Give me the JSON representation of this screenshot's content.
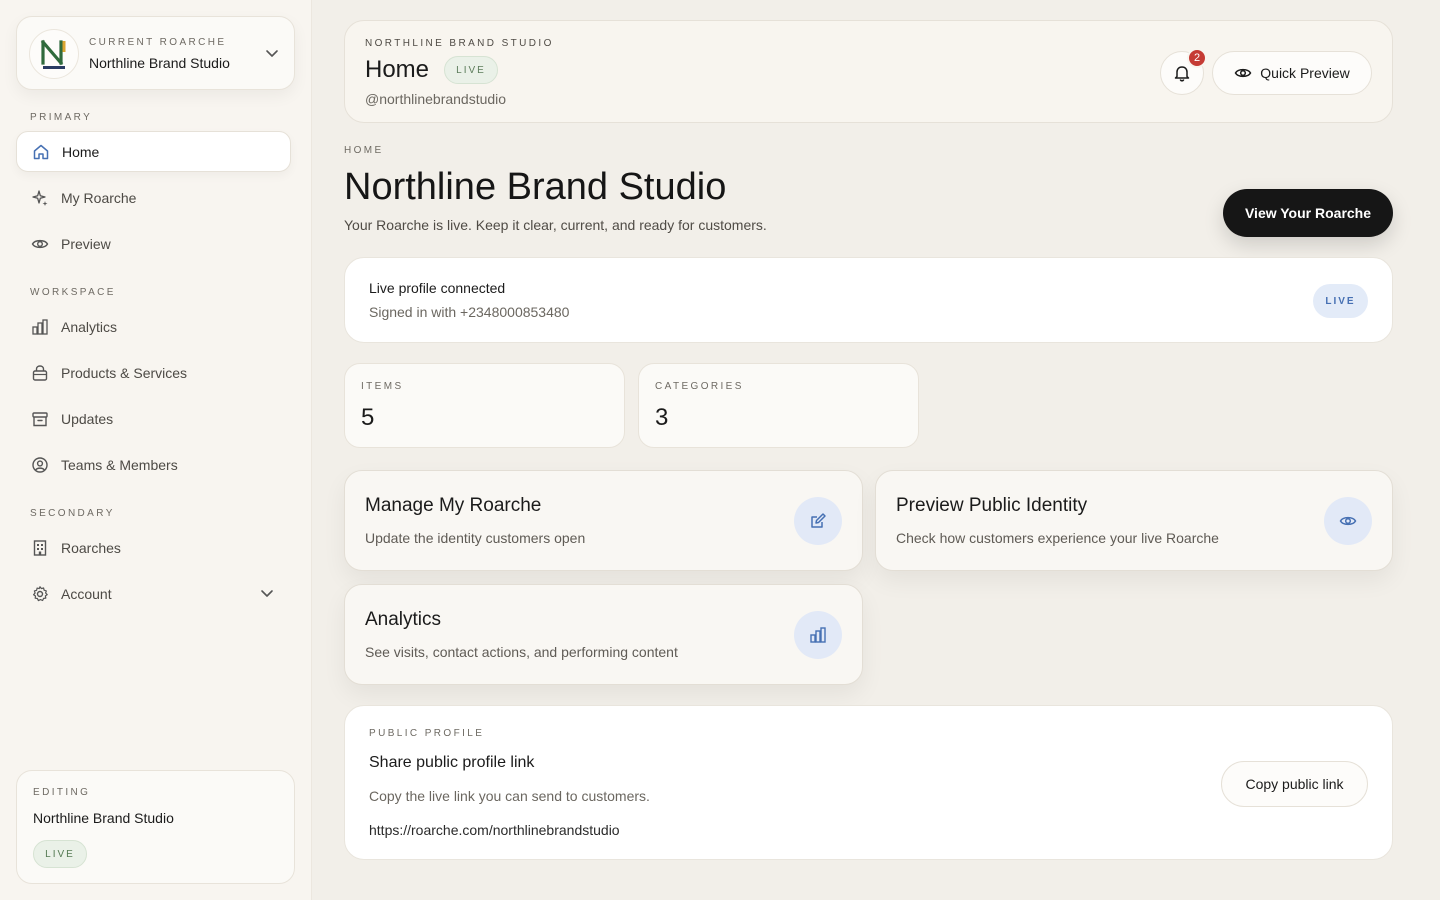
{
  "colors": {
    "accent": "#4670b3",
    "live_green": "#557a53",
    "badge_red": "#c53b34",
    "dark_button": "#161616"
  },
  "sidebar": {
    "switcher": {
      "eyebrow": "CURRENT ROARCHE",
      "name": "Northline Brand Studio",
      "logo_icon": "n-monogram-logo",
      "chevron_icon": "chevron-down-icon"
    },
    "sections": {
      "primary": "PRIMARY",
      "workspace": "WORKSPACE",
      "secondary": "SECONDARY"
    },
    "items": [
      {
        "label": "Home",
        "icon": "home-icon",
        "active": true
      },
      {
        "label": "My Roarche",
        "icon": "sparkle-icon"
      },
      {
        "label": "Preview",
        "icon": "eye-icon"
      },
      {
        "label": "Analytics",
        "icon": "bar-chart-icon"
      },
      {
        "label": "Products & Services",
        "icon": "shopping-bag-icon"
      },
      {
        "label": "Updates",
        "icon": "archive-icon"
      },
      {
        "label": "Teams & Members",
        "icon": "user-circle-icon"
      },
      {
        "label": "Roarches",
        "icon": "building-icon"
      },
      {
        "label": "Account",
        "icon": "gear-icon",
        "expandable": true
      }
    ],
    "editing": {
      "eyebrow": "EDITING",
      "name": "Northline Brand Studio",
      "status": "LIVE"
    }
  },
  "header": {
    "eyebrow": "NORTHLINE BRAND STUDIO",
    "title": "Home",
    "status": "LIVE",
    "handle": "@northlinebrandstudio",
    "notification_count": "2",
    "quick_preview": "Quick Preview"
  },
  "main": {
    "eyebrow": "HOME",
    "title": "Northline Brand Studio",
    "subtitle": "Your Roarche is live. Keep it clear, current, and ready for customers.",
    "view_button": "View Your Roarche",
    "connection": {
      "title": "Live profile connected",
      "subtitle": "Signed in with +2348000853480",
      "status": "LIVE"
    },
    "stats": [
      {
        "label": "ITEMS",
        "value": "5"
      },
      {
        "label": "CATEGORIES",
        "value": "3"
      }
    ],
    "actions": [
      {
        "title": "Manage My Roarche",
        "subtitle": "Update the identity customers open",
        "icon": "edit-icon"
      },
      {
        "title": "Preview Public Identity",
        "subtitle": "Check how customers experience your live Roarche",
        "icon": "eye-icon"
      },
      {
        "title": "Analytics",
        "subtitle": "See visits, contact actions, and performing content",
        "icon": "bar-chart-icon"
      }
    ],
    "share": {
      "eyebrow": "PUBLIC PROFILE",
      "title": "Share public profile link",
      "subtitle": "Copy the live link you can send to customers.",
      "link": "https://roarche.com/northlinebrandstudio",
      "button": "Copy public link"
    }
  }
}
